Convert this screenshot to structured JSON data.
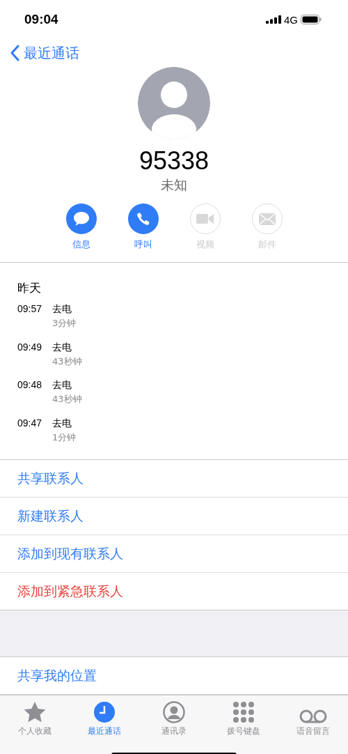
{
  "status_bar": {
    "time": "09:04",
    "network": "4G"
  },
  "nav": {
    "back": "最近通话"
  },
  "contact": {
    "number": "95338",
    "label": "未知"
  },
  "actions": [
    {
      "kind": "message",
      "label": "信息",
      "disabled": false
    },
    {
      "kind": "call",
      "label": "呼叫",
      "disabled": false
    },
    {
      "kind": "video",
      "label": "视频",
      "disabled": true
    },
    {
      "kind": "mail",
      "label": "邮件",
      "disabled": true
    }
  ],
  "history": {
    "date": "昨天",
    "calls": [
      {
        "time": "09:57",
        "type": "去电",
        "duration": "3分钟"
      },
      {
        "time": "09:49",
        "type": "去电",
        "duration": "43秒钟"
      },
      {
        "time": "09:48",
        "type": "去电",
        "duration": "43秒钟"
      },
      {
        "time": "09:47",
        "type": "去电",
        "duration": "1分钟"
      }
    ]
  },
  "options": [
    {
      "label": "共享联系人",
      "kind": "normal"
    },
    {
      "label": "新建联系人",
      "kind": "normal"
    },
    {
      "label": "添加到现有联系人",
      "kind": "normal"
    },
    {
      "label": "添加到紧急联系人",
      "kind": "destructive"
    }
  ],
  "location_option": {
    "label": "共享我的位置"
  },
  "tabs": [
    {
      "kind": "favorites",
      "label": "个人收藏",
      "selected": false
    },
    {
      "kind": "recents",
      "label": "最近通话",
      "selected": true
    },
    {
      "kind": "contacts",
      "label": "通讯录",
      "selected": false
    },
    {
      "kind": "keypad",
      "label": "拨号键盘",
      "selected": false
    },
    {
      "kind": "voicemail",
      "label": "语音留言",
      "selected": false
    }
  ]
}
